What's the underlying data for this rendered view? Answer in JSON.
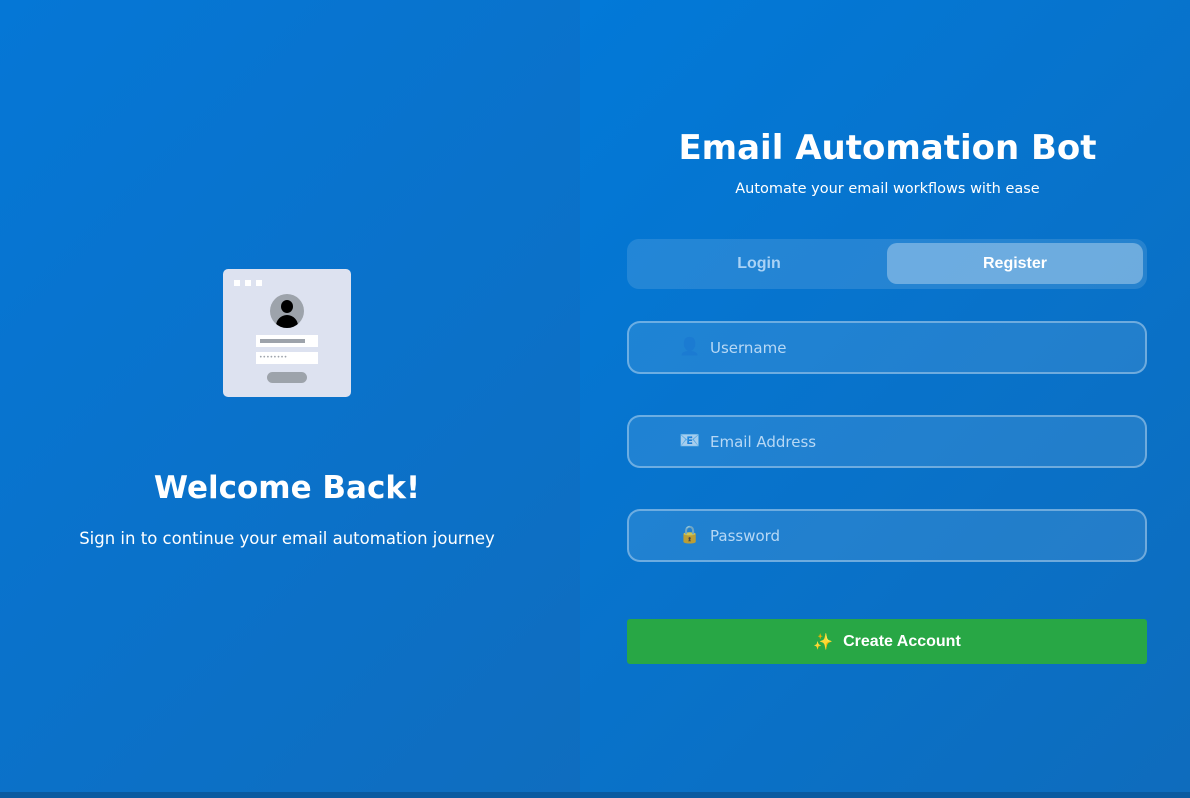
{
  "left": {
    "welcome_title": "Welcome Back!",
    "welcome_subtitle": "Sign in to continue your email automation journey",
    "illustration_password_mask": "••••••••"
  },
  "header": {
    "title": "Email Automation Bot",
    "subtitle": "Automate your email workflows with ease"
  },
  "tabs": [
    {
      "label": "Login",
      "active": false
    },
    {
      "label": "Register",
      "active": true
    }
  ],
  "form": {
    "fields": [
      {
        "name": "username",
        "placeholder": "Username",
        "value": "",
        "icon": "user-icon"
      },
      {
        "name": "email",
        "placeholder": "Email Address",
        "value": "",
        "icon": "email-icon"
      },
      {
        "name": "password",
        "placeholder": "Password",
        "value": "",
        "icon": "lock-icon"
      }
    ],
    "submit_label": "Create Account",
    "submit_icon": "sparkles-icon"
  },
  "colors": {
    "background": "#0277d4",
    "submit": "#28a745"
  }
}
